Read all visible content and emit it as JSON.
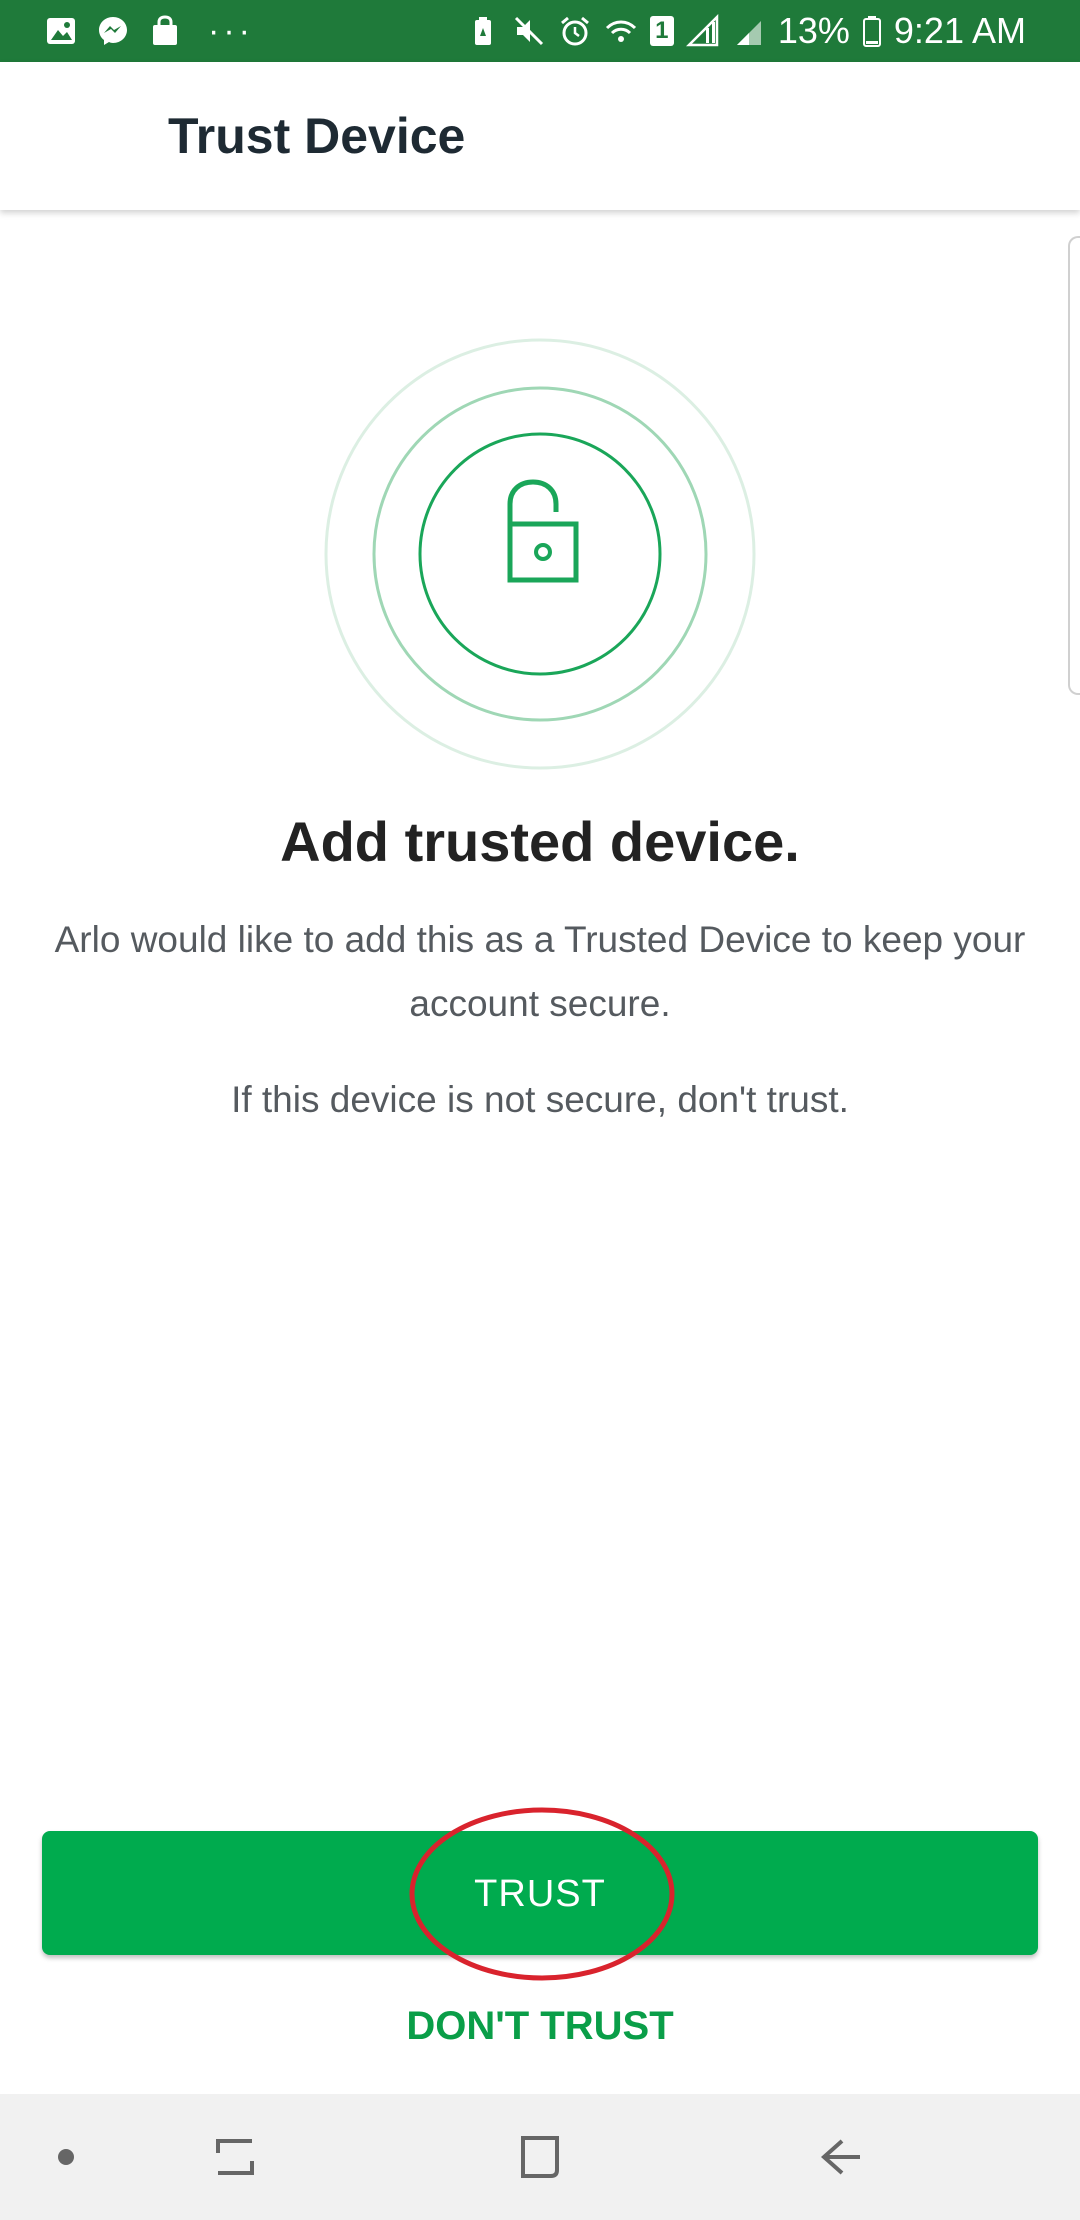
{
  "status_bar": {
    "battery_percent": "13%",
    "time": "9:21 AM",
    "overflow": "···",
    "sim_slot": "1",
    "icons": [
      "gallery-icon",
      "messenger-icon",
      "shopping-bag-icon",
      "battery-saver-icon",
      "mute-icon",
      "alarm-icon",
      "wifi-icon",
      "signal-icon",
      "signal-icon",
      "battery-icon"
    ]
  },
  "app_bar": {
    "title": "Trust Device"
  },
  "illustration": {
    "icon": "unlocked-padlock-icon"
  },
  "content": {
    "headline": "Add trusted device.",
    "description": "Arlo would like to add this as a Trusted Device to keep your account secure.",
    "warning": "If this device is not secure, don't trust."
  },
  "actions": {
    "primary_label": "TRUST",
    "secondary_label": "DON'T TRUST"
  },
  "nav_bar": {
    "icons": [
      "dot-icon",
      "recent-apps-icon",
      "home-icon",
      "back-icon"
    ]
  },
  "colors": {
    "status_bar": "#1f7a3a",
    "accent": "#00ab4e",
    "secondary_action": "#0a9e48",
    "annotation": "#d9232d"
  }
}
